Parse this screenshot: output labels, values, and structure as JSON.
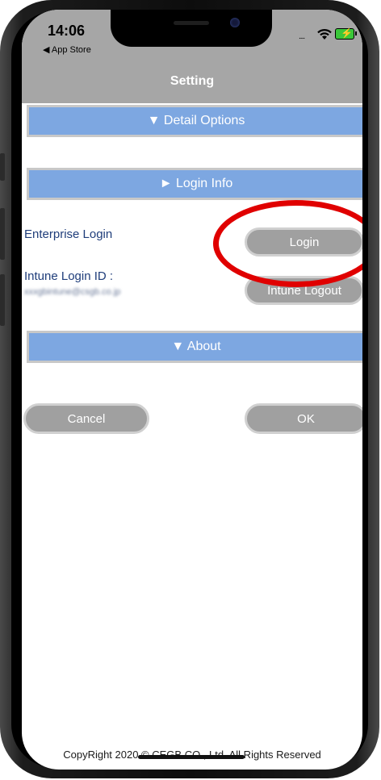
{
  "status_bar": {
    "time": "14:06",
    "back_app": "◀ App Store",
    "signal": "....",
    "bolt": "⚡"
  },
  "nav": {
    "title": "Setting"
  },
  "sections": {
    "detail_options": "▼ Detail Options",
    "login_info": "► Login Info",
    "about": "▼ About"
  },
  "login": {
    "enterprise_label": "Enterprise Login",
    "login_button": "Login",
    "intune_label": "Intune Login ID :",
    "intune_id": "xxxgbintune@csgb.co.jp",
    "intune_logout_button": "Intune Logout"
  },
  "actions": {
    "cancel": "Cancel",
    "ok": "OK"
  },
  "footer": {
    "copyright": "CopyRight 2020 © CEGB CO., Ltd. All Rights Reserved"
  },
  "colors": {
    "section": "#7da7e1",
    "header": "#a6a6a6",
    "button": "#a0a0a0",
    "highlight": "#e00000"
  },
  "icons": [
    "wifi-icon",
    "battery-icon",
    "back-arrow-icon"
  ]
}
